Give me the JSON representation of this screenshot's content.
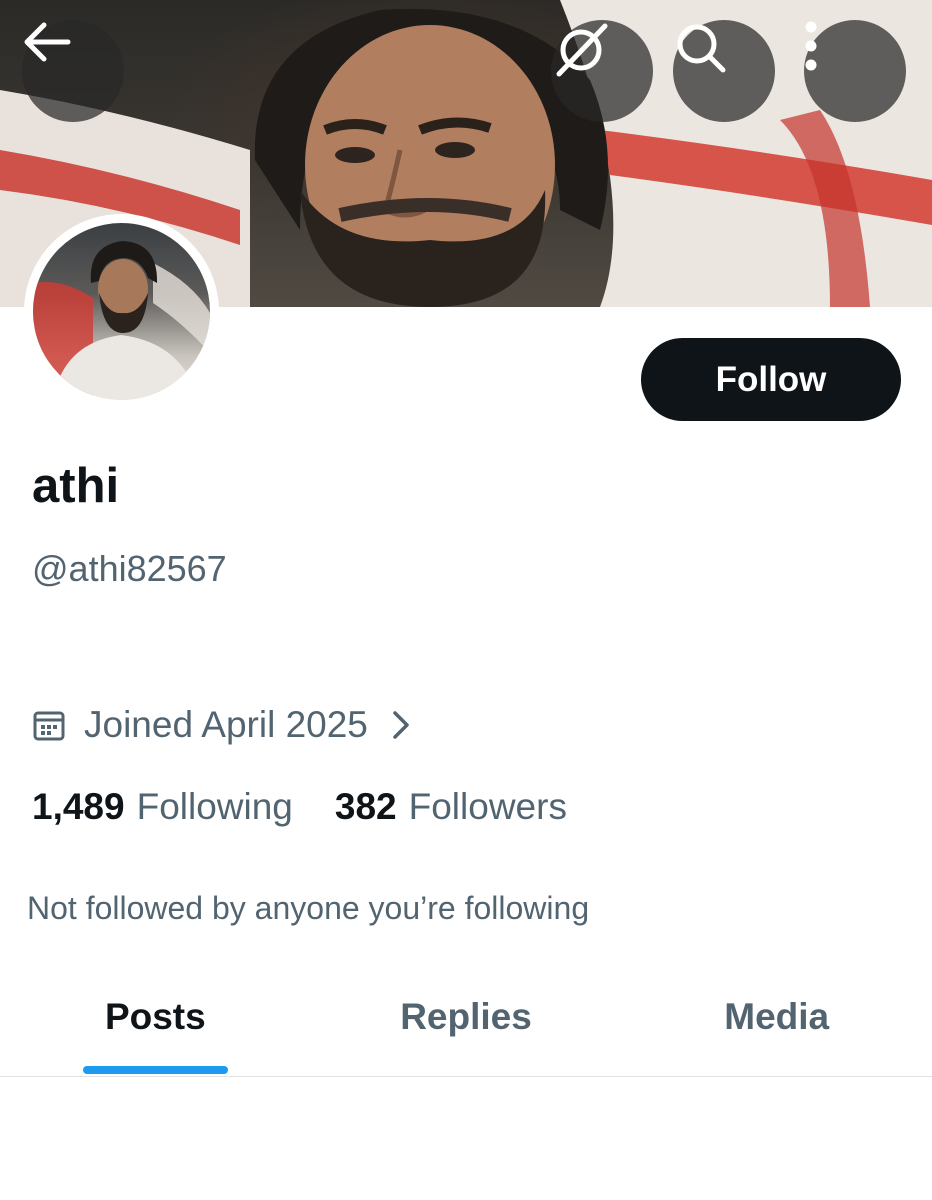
{
  "header": {
    "back_icon": "arrow-left-icon",
    "grok_icon": "grok-icon",
    "search_icon": "search-icon",
    "more_icon": "more-vertical-icon"
  },
  "profile": {
    "display_name": "athi",
    "handle": "@athi82567",
    "follow_label": "Follow",
    "joined": "Joined April 2025",
    "following_count": "1,489",
    "following_label": "Following",
    "followers_count": "382",
    "followers_label": "Followers",
    "not_followed_text": "Not followed by anyone you’re following"
  },
  "tabs": [
    {
      "label": "Posts",
      "active": true
    },
    {
      "label": "Replies",
      "active": false
    },
    {
      "label": "Media",
      "active": false
    }
  ],
  "colors": {
    "accent": "#1d9bf0",
    "text_primary": "#0f1419",
    "text_secondary": "#536471",
    "follow_bg": "#0f1419"
  }
}
